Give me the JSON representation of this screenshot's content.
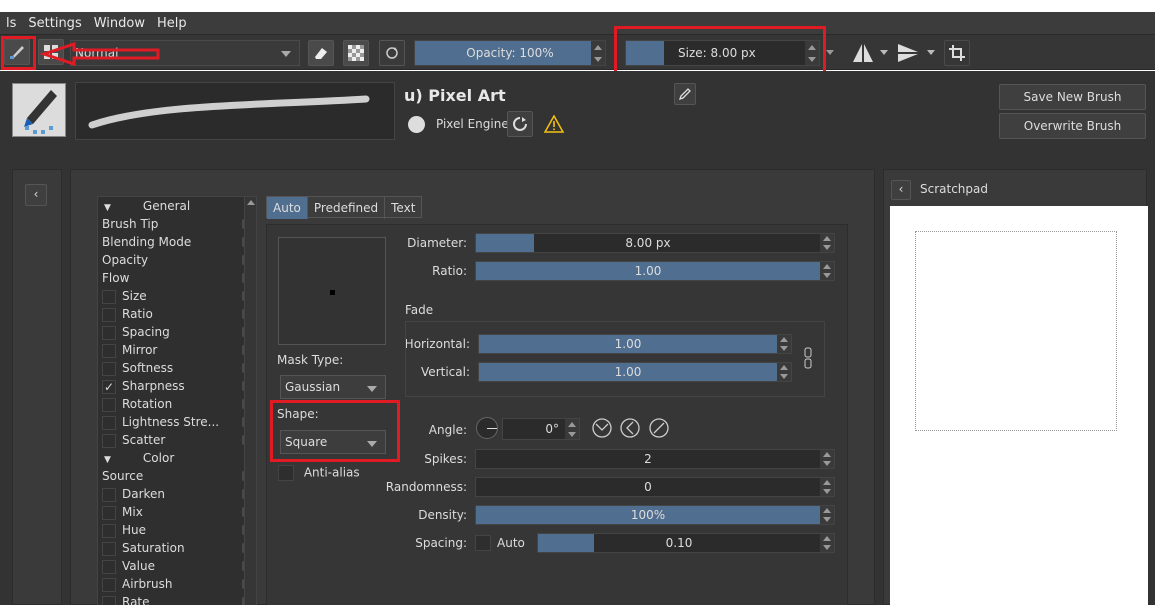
{
  "menu": {
    "items": [
      {
        "label": "ls"
      },
      {
        "label": "Settings"
      },
      {
        "label": "Window"
      },
      {
        "label": "Help"
      }
    ]
  },
  "toolbar": {
    "blend_mode": "Normal",
    "opacity_label": "Opacity: 100%",
    "opacity_value": 1.0,
    "size_label": "Size: 8.00 px"
  },
  "preset": {
    "name": "u) Pixel Art",
    "engine": "Pixel Engine",
    "save_new": "Save New Brush Preset...",
    "overwrite": "Overwrite Brush"
  },
  "categories": {
    "general_header": "General",
    "general": [
      {
        "label": "Brush Tip",
        "check": false,
        "has_cb": false
      },
      {
        "label": "Blending Mode",
        "check": false,
        "has_cb": false
      },
      {
        "label": "Opacity",
        "check": false,
        "has_cb": false
      },
      {
        "label": "Flow",
        "check": false,
        "has_cb": false
      },
      {
        "label": "Size",
        "check": false,
        "has_cb": true
      },
      {
        "label": "Ratio",
        "check": false,
        "has_cb": true
      },
      {
        "label": "Spacing",
        "check": false,
        "has_cb": true
      },
      {
        "label": "Mirror",
        "check": false,
        "has_cb": true
      },
      {
        "label": "Softness",
        "check": false,
        "has_cb": true
      },
      {
        "label": "Sharpness",
        "check": true,
        "has_cb": true
      },
      {
        "label": "Rotation",
        "check": false,
        "has_cb": true
      },
      {
        "label": "Lightness Stre...",
        "check": false,
        "has_cb": true
      },
      {
        "label": "Scatter",
        "check": false,
        "has_cb": true
      }
    ],
    "color_header": "Color",
    "color": [
      {
        "label": "Source",
        "check": false,
        "has_cb": false
      },
      {
        "label": "Darken",
        "check": false,
        "has_cb": true
      },
      {
        "label": "Mix",
        "check": false,
        "has_cb": true
      },
      {
        "label": "Hue",
        "check": false,
        "has_cb": true
      },
      {
        "label": "Saturation",
        "check": false,
        "has_cb": true
      },
      {
        "label": "Value",
        "check": false,
        "has_cb": true
      },
      {
        "label": "Airbrush",
        "check": false,
        "has_cb": true
      },
      {
        "label": "Rate",
        "check": false,
        "has_cb": true
      }
    ]
  },
  "tabs": [
    {
      "label": "Auto"
    },
    {
      "label": "Predefined"
    },
    {
      "label": "Text"
    }
  ],
  "tip": {
    "mask_type_label": "Mask Type:",
    "mask_type": "Gaussian",
    "shape_label": "Shape:",
    "shape": "Square",
    "antialias_label": "Anti-alias",
    "fade_label": "Fade",
    "params": {
      "diameter": {
        "label": "Diameter:",
        "value": "8.00 px",
        "fill": 0.17
      },
      "ratio": {
        "label": "Ratio:",
        "value": "1.00",
        "fill": 1.0
      },
      "horizontal": {
        "label": "Horizontal:",
        "value": "1.00",
        "fill": 1.0
      },
      "vertical": {
        "label": "Vertical:",
        "value": "1.00",
        "fill": 1.0
      },
      "angle": {
        "label": "Angle:",
        "value": "0°"
      },
      "spikes": {
        "label": "Spikes:",
        "value": "2",
        "fill": 0.0
      },
      "randomness": {
        "label": "Randomness:",
        "value": "0",
        "fill": 0.0
      },
      "density": {
        "label": "Density:",
        "value": "100%",
        "fill": 1.0
      },
      "spacing": {
        "label": "Spacing:",
        "auto_label": "Auto",
        "value": "0.10",
        "fill": 0.2
      }
    }
  },
  "scratchpad": {
    "title": "Scratchpad"
  },
  "colors": {
    "accent": "#506e8f",
    "highlight": "#e01b24"
  }
}
